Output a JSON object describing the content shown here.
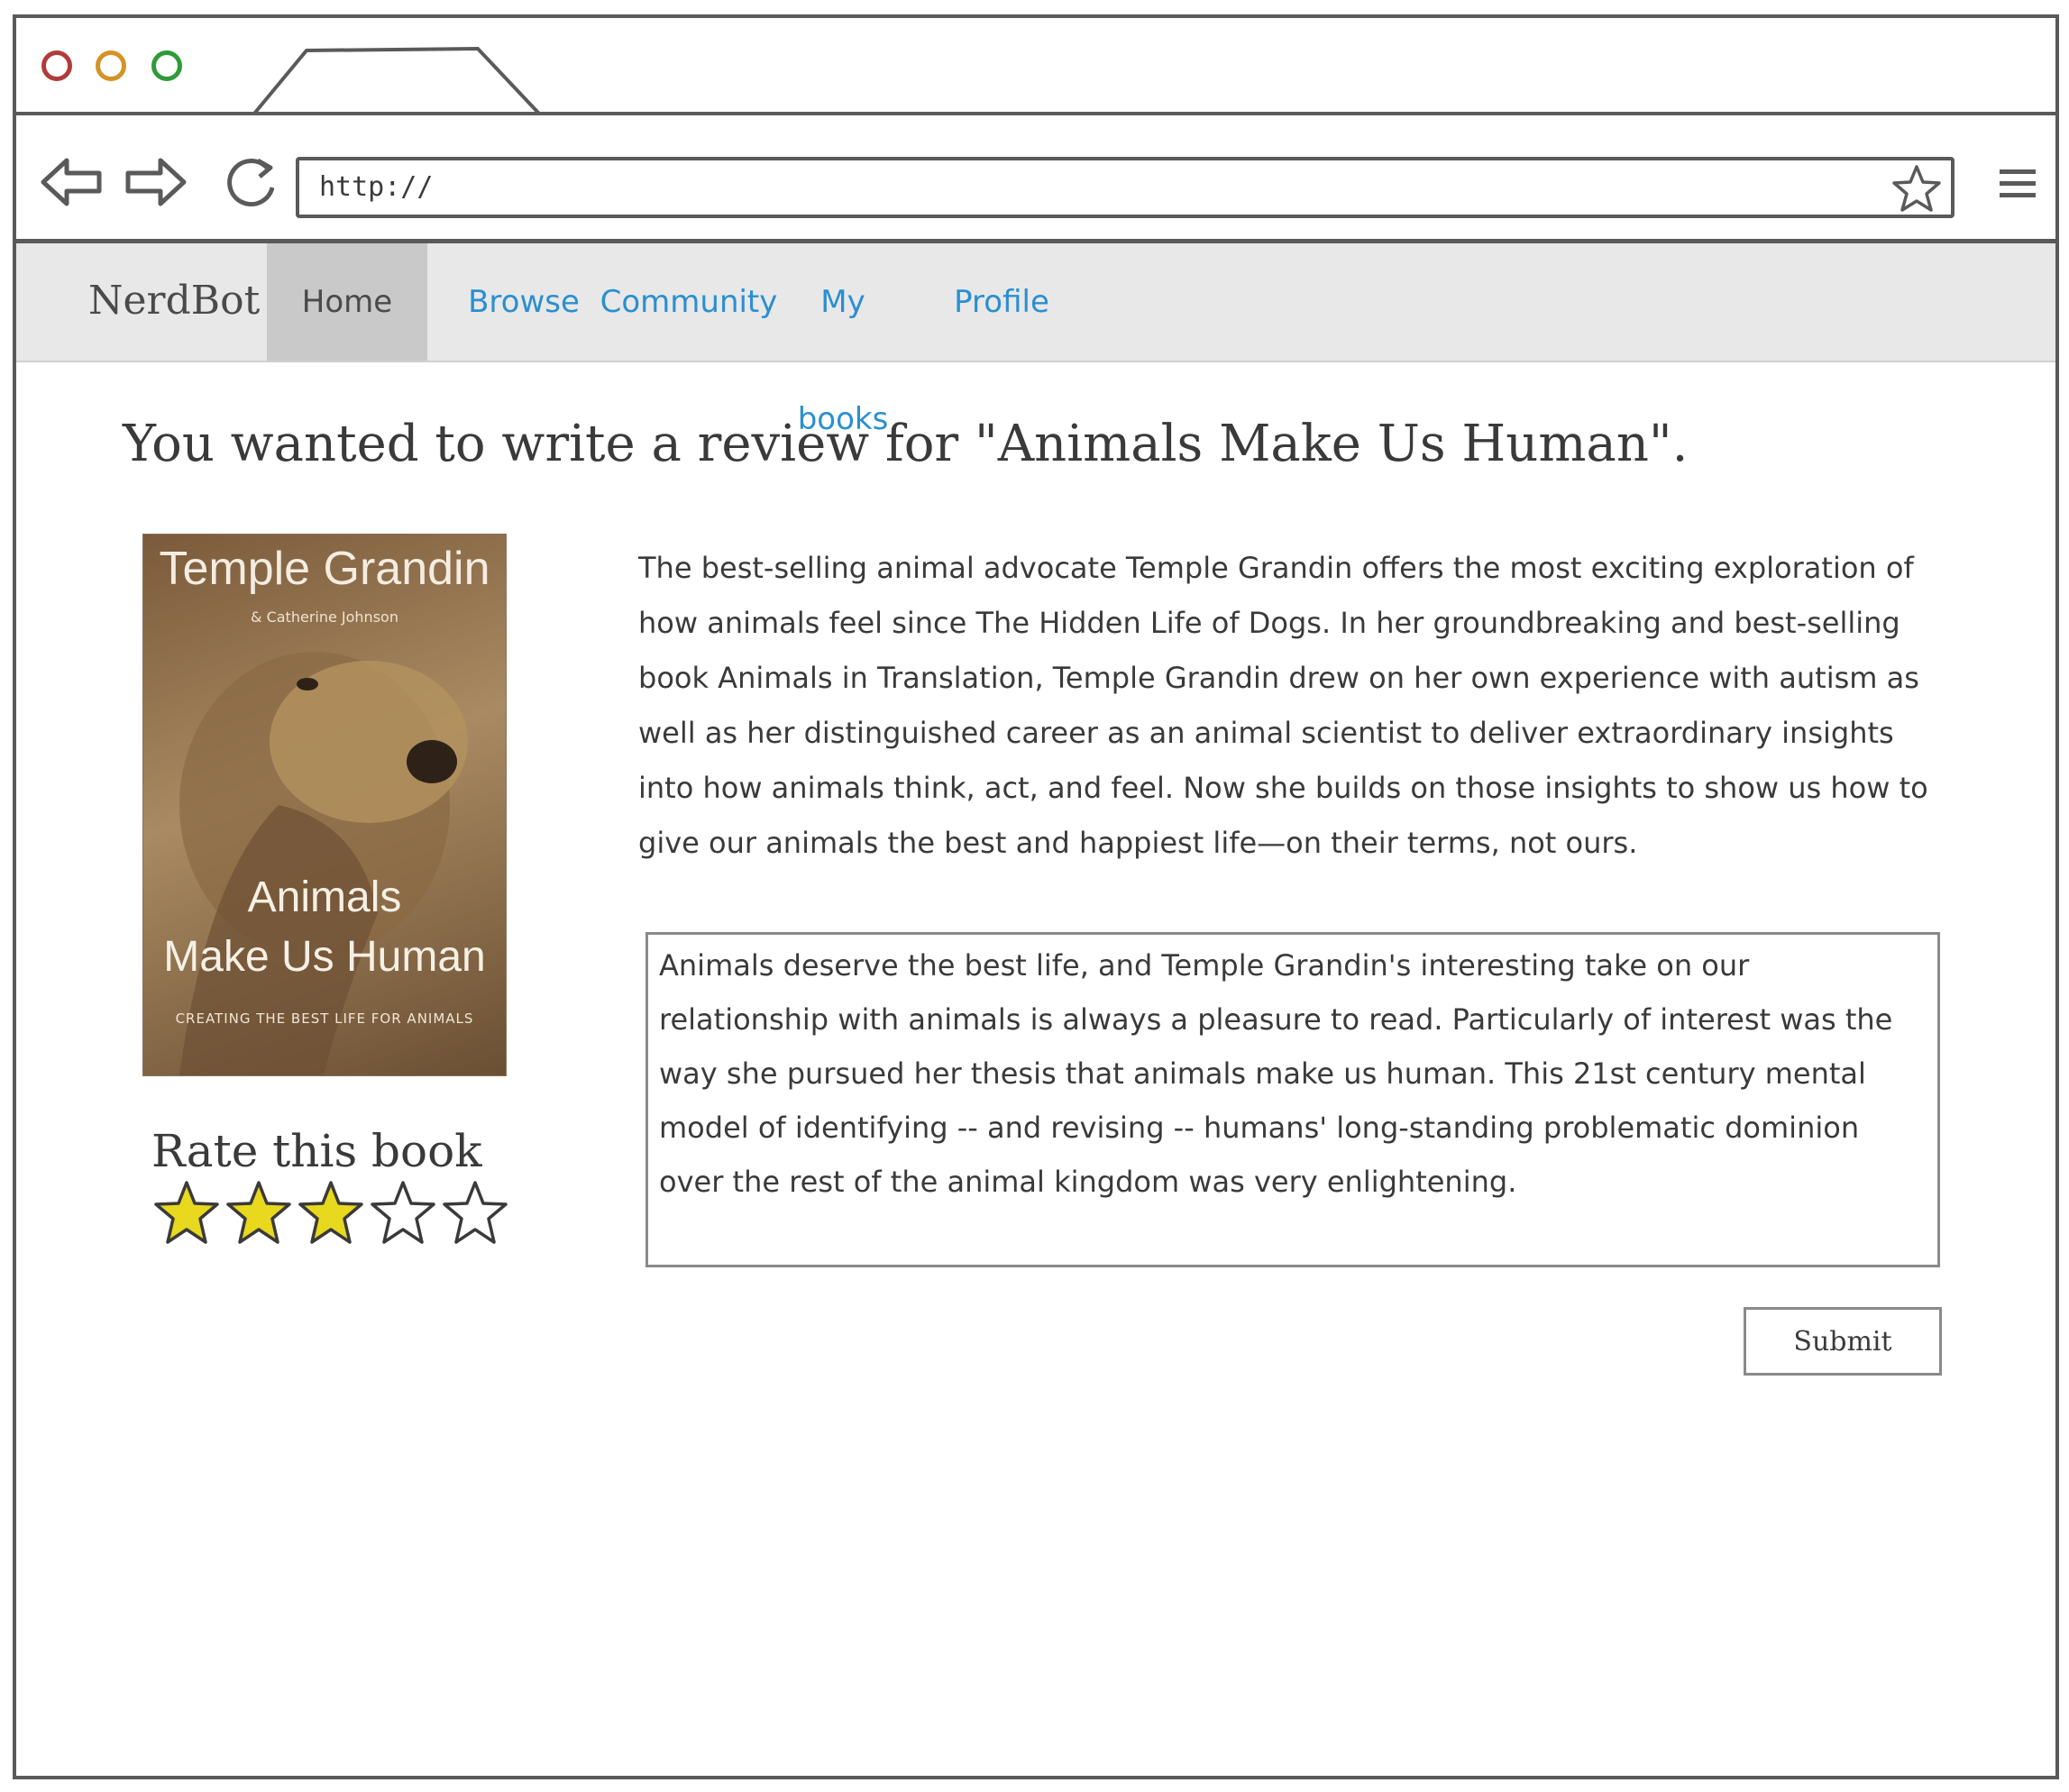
{
  "browser": {
    "address": "http://",
    "controls": {
      "close_color": "#b03b3b",
      "minimize_color": "#d49326",
      "maximize_color": "#2f9a3a"
    }
  },
  "app": {
    "brand": "NerdBot",
    "nav": [
      {
        "label": "Home",
        "active": true
      },
      {
        "label": "Browse",
        "active": false
      },
      {
        "label": "Community",
        "active": false
      },
      {
        "label": "My books",
        "active": false
      },
      {
        "label": "Profile",
        "active": false
      }
    ],
    "link_color": "#2a8fd1"
  },
  "page": {
    "heading": "You wanted to write a review for \"Animals Make Us Human\".",
    "cover": {
      "author": "Temple Grandin",
      "coauthor": "& Catherine Johnson",
      "title_line1": "Animals",
      "title_line2": "Make Us Human",
      "tagline": "CREATING THE BEST LIFE FOR ANIMALS"
    },
    "rating": {
      "label": "Rate this book",
      "value": 3,
      "max": 5,
      "filled_color": "#e8d81e"
    },
    "description": "The best-selling animal advocate Temple Grandin offers the most exciting exploration of how animals feel since The Hidden Life of Dogs. In her groundbreaking and best-selling book Animals in Translation, Temple Grandin drew on her own experience with autism as well as her distinguished career as an animal scientist to deliver extraordinary insights into how animals think, act, and feel. Now she builds on those insights to show us how to give our animals the best and happiest life—on their terms, not ours.",
    "review_text": "Animals deserve the best life, and Temple Grandin's interesting take on our relationship with animals is always a pleasure to read. Particularly of interest was the way she pursued her thesis that animals make us human. This 21st century mental model of identifying -- and revising -- humans' long-standing problematic dominion over the rest of the animal kingdom was very enlightening.",
    "submit_label": "Submit"
  }
}
